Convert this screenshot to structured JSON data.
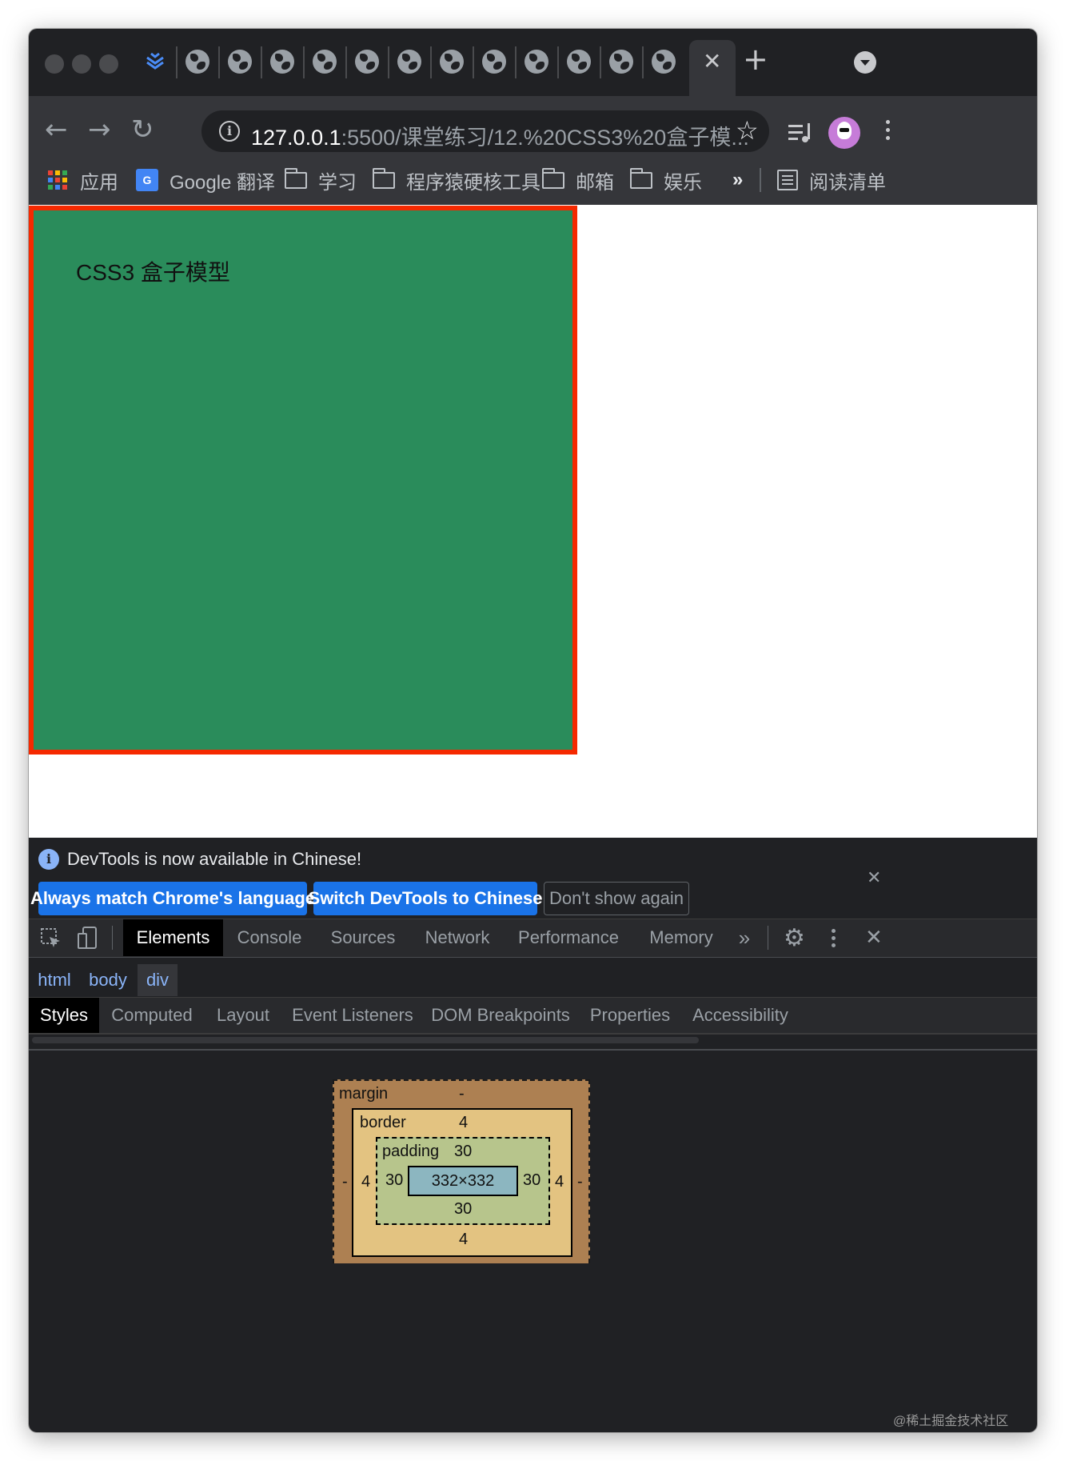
{
  "browser": {
    "url_host": "127.0.0.1",
    "url_rest": ":5500/课堂练习/12.%20CSS3%20盒子模...",
    "tab_icons": [
      "layers-icon",
      "globe-icon",
      "globe-icon",
      "globe-icon",
      "globe-icon",
      "globe-icon",
      "globe-icon",
      "globe-icon",
      "globe-icon",
      "globe-icon",
      "globe-icon",
      "globe-icon",
      "globe-icon"
    ],
    "bookmarks": [
      {
        "label": "应用",
        "icon": "apps-grid-icon"
      },
      {
        "label": "Google 翻译",
        "icon": "google-translate-icon"
      },
      {
        "label": "学习",
        "icon": "folder-icon"
      },
      {
        "label": "程序猿硬核工具",
        "icon": "folder-icon"
      },
      {
        "label": "邮箱",
        "icon": "folder-icon"
      },
      {
        "label": "娱乐",
        "icon": "folder-icon"
      }
    ],
    "bookmarks_more": "»",
    "reading_list": "阅读清单"
  },
  "page": {
    "box_text": "CSS3 盒子模型",
    "box_bg_color": "#2a8c5b",
    "box_border_color": "#f52900"
  },
  "devtools": {
    "infobar": {
      "message": "DevTools is now available in Chinese!",
      "btn_match": "Always match Chrome's language",
      "btn_switch": "Switch DevTools to Chinese",
      "btn_dont_show": "Don't show again"
    },
    "tabs": [
      "Elements",
      "Console",
      "Sources",
      "Network",
      "Performance",
      "Memory"
    ],
    "tabs_more": "»",
    "breadcrumbs": [
      "html",
      "body",
      "div"
    ],
    "sub_tabs": [
      "Styles",
      "Computed",
      "Layout",
      "Event Listeners",
      "DOM Breakpoints",
      "Properties",
      "Accessibility"
    ],
    "box_model": {
      "margin_label": "margin",
      "margin_top": "-",
      "margin_left": "-",
      "margin_right": "-",
      "border_label": "border",
      "border_top": "4",
      "border_left": "4",
      "border_right": "4",
      "border_bottom": "4",
      "padding_label": "padding",
      "padding_top": "30",
      "padding_left": "30",
      "padding_right": "30",
      "padding_bottom": "30",
      "content_size": "332×332"
    }
  },
  "watermark": "@稀土掘金技术社区"
}
